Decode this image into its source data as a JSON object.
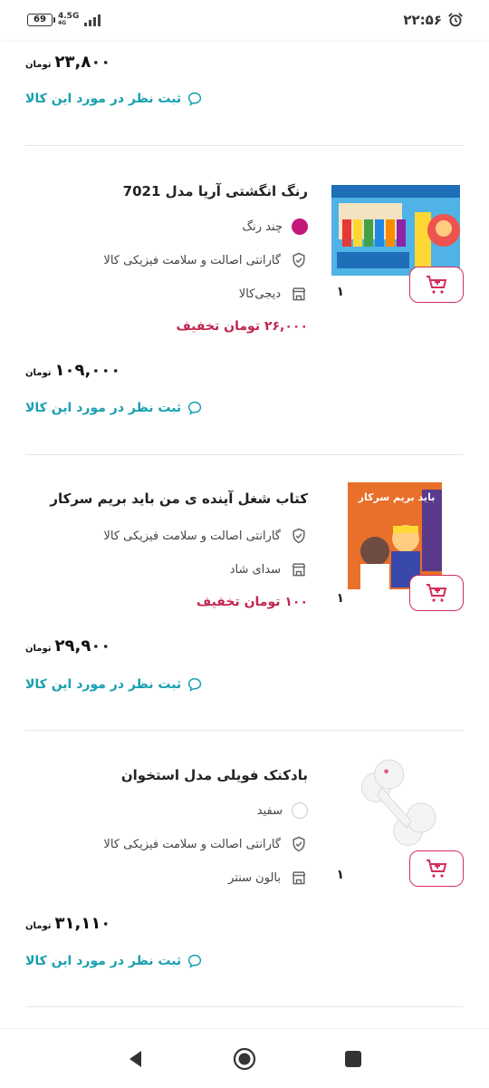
{
  "status": {
    "battery": "69",
    "network": "4.5G",
    "network_sub": "4G",
    "time": "۲۲:۵۶"
  },
  "top_item": {
    "price": "۲۳,۸۰۰",
    "currency": "تومان",
    "comment_label": "ثبت نظر در مورد این کالا"
  },
  "items": [
    {
      "title": "رنگ انگشتی آریا مدل 7021",
      "color_label": "چند رنگ",
      "color_hex": "#c2187a",
      "warranty": "گارانتی اصالت و سلامت فیزیکی کالا",
      "seller": "دیجی‌کالا",
      "discount": "۲۶,۰۰۰ تومان تخفیف",
      "quantity": "۱",
      "price": "۱۰۹,۰۰۰",
      "currency": "تومان",
      "comment_label": "ثبت نظر در مورد این کالا",
      "image_icon": "finger-paint-box-image"
    },
    {
      "title": "کتاب شغل آینده ی من باید بریم سرکار",
      "warranty": "گارانتی اصالت و سلامت فیزیکی کالا",
      "seller": "سدای شاد",
      "discount": "۱۰۰ تومان تخفیف",
      "quantity": "۱",
      "price": "۲۹,۹۰۰",
      "currency": "تومان",
      "comment_label": "ثبت نظر در مورد این کالا",
      "image_icon": "book-cover-image",
      "book_cover_text": "باید بریم سرکار"
    },
    {
      "title": "بادکنک فویلی مدل استخوان",
      "color_label": "سفید",
      "color_hex": "#ffffff",
      "warranty": "گارانتی اصالت و سلامت فیزیکی کالا",
      "seller": "بالون سنتر",
      "quantity": "۱",
      "price": "۳۱,۱۱۰",
      "currency": "تومان",
      "comment_label": "ثبت نظر در مورد این کالا",
      "image_icon": "bone-balloon-image"
    }
  ],
  "colors": {
    "accent_teal": "#19a0b0",
    "discount_red": "#c0254f",
    "cart_red": "#d32f5a"
  }
}
